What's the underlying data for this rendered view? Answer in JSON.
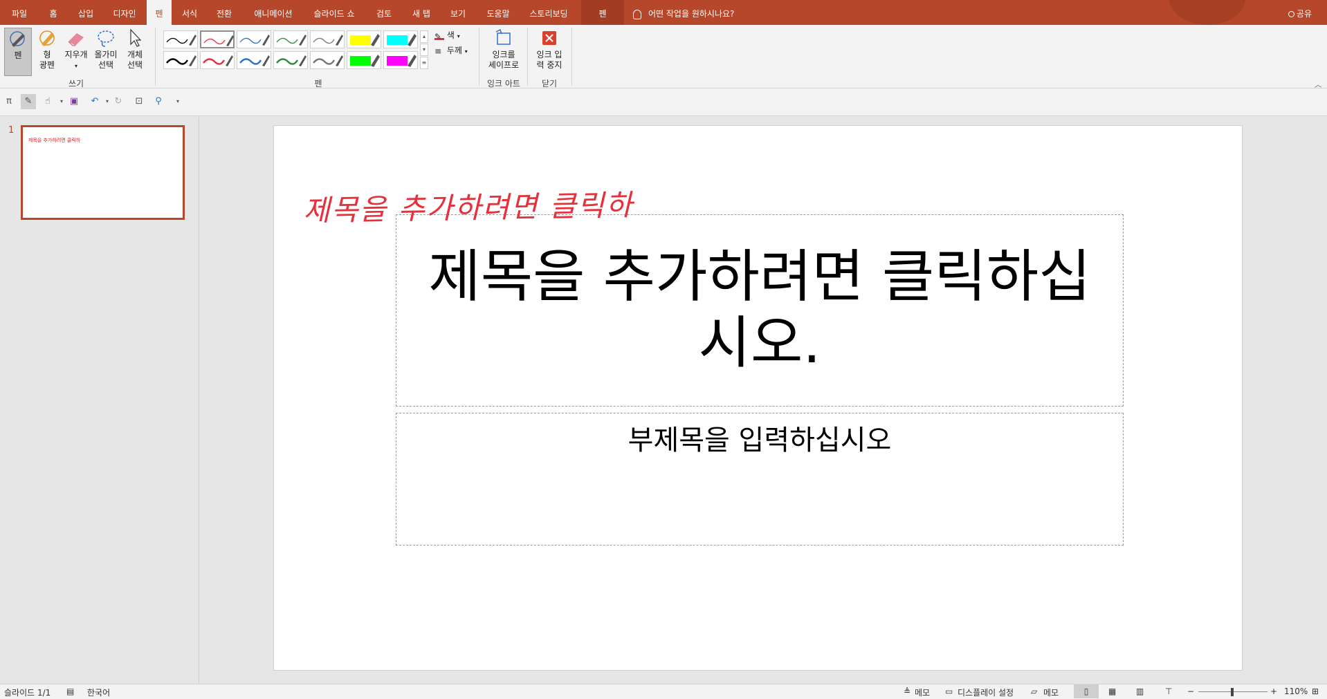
{
  "tabs": [
    {
      "label": "파일"
    },
    {
      "label": "홈"
    },
    {
      "label": "삽입"
    },
    {
      "label": "디자인"
    },
    {
      "label": "펜"
    },
    {
      "label": "서식"
    },
    {
      "label": "전환"
    },
    {
      "label": "애니메이션"
    },
    {
      "label": "슬라이드 쇼"
    },
    {
      "label": "검토"
    },
    {
      "label": "새 탭"
    },
    {
      "label": "보기"
    },
    {
      "label": "도움말"
    },
    {
      "label": "스토리보딩"
    },
    {
      "label": "펜"
    }
  ],
  "tell_me": "어떤 작업을 원하시나요?",
  "share_label": "공유",
  "ribbon": {
    "write_group": {
      "label": "쓰기",
      "pen": "펜",
      "highlighter_1": "형",
      "highlighter_2": "광펜",
      "eraser": "지우개",
      "lasso_1": "올가미",
      "lasso_2": "선택",
      "object_1": "개체",
      "object_2": "선택"
    },
    "pens_group": {
      "label": "펜",
      "color": "색",
      "thickness": "두께",
      "pens": [
        {
          "color": "#000000"
        },
        {
          "color": "#e8303c"
        },
        {
          "color": "#2f6fce"
        },
        {
          "color": "#2e8b3e"
        },
        {
          "color": "#777777"
        },
        {
          "color": "#ffff00"
        },
        {
          "color": "#00ffff"
        },
        {
          "color": "#000000"
        },
        {
          "color": "#e8303c"
        },
        {
          "color": "#2f6fce"
        },
        {
          "color": "#2e8b3e"
        },
        {
          "color": "#777777"
        },
        {
          "color": "#00ff00"
        },
        {
          "color": "#ff00ff"
        }
      ]
    },
    "ink_art_group": {
      "label": "잉크 아트",
      "btn_1": "잉크를",
      "btn_2": "셰이프로"
    },
    "close_group": {
      "label": "닫기",
      "btn_1": "잉크 입",
      "btn_2": "력 중지"
    }
  },
  "thumbnail": {
    "number": "1",
    "title": "제목을 추가하려면 클릭하"
  },
  "slide": {
    "ink_text": "제목을 추가하려면 클릭하",
    "title": "제목을 추가하려면 클릭하십시오.",
    "subtitle": "부제목을 입력하십시오"
  },
  "status": {
    "slide_count": "슬라이드 1/1",
    "language": "한국어",
    "notes": "메모",
    "display_settings": "디스플레이 설정",
    "comments": "메모",
    "zoom": "110%"
  },
  "colors": {
    "brand": "#b7472a",
    "ink_red": "#e8303c"
  }
}
